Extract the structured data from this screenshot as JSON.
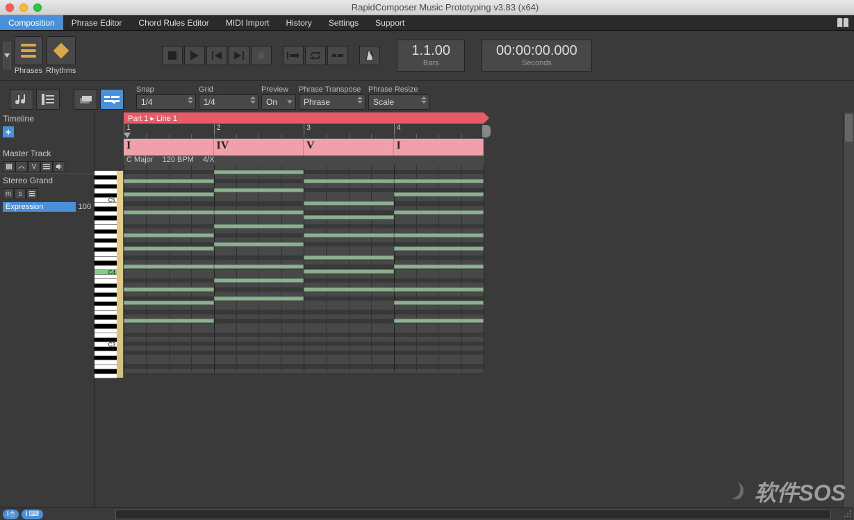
{
  "window": {
    "title": "RapidComposer Music Prototyping v3.83 (x64)"
  },
  "menu": {
    "items": [
      "Composition",
      "Phrase Editor",
      "Chord Rules Editor",
      "MIDI Import",
      "History",
      "Settings",
      "Support"
    ],
    "active_index": 0
  },
  "toolbar": {
    "phrases_label": "Phrases",
    "rhythms_label": "Rhythms",
    "bars_counter": "1.1.00",
    "bars_label": "Bars",
    "seconds_counter": "00:00:00.000",
    "seconds_label": "Seconds"
  },
  "params": {
    "snap_label": "Snap",
    "snap_value": "1/4",
    "grid_label": "Grid",
    "grid_value": "1/4",
    "preview_label": "Preview",
    "preview_value": "On",
    "phrase_transpose_label": "Phrase Transpose",
    "phrase_transpose_value": "Phrase",
    "phrase_resize_label": "Phrase Resize",
    "phrase_resize_value": "Scale"
  },
  "sidebar": {
    "timeline_label": "Timeline",
    "master_track_label": "Master Track",
    "track_name": "Stereo Grand",
    "expression_label": "Expression",
    "expression_value": "100"
  },
  "arrangement": {
    "part_label": "Part 1 ▸ Line 1",
    "bars": [
      "1",
      "2",
      "3",
      "4"
    ],
    "chords": [
      "I",
      "IV",
      "V",
      "I"
    ],
    "key": "C Major",
    "tempo": "120 BPM",
    "time_sig": "4/X"
  },
  "piano_labels": {
    "c5": "C5",
    "c4": "C4",
    "c3": "C3"
  },
  "watermark": "软件SOS"
}
